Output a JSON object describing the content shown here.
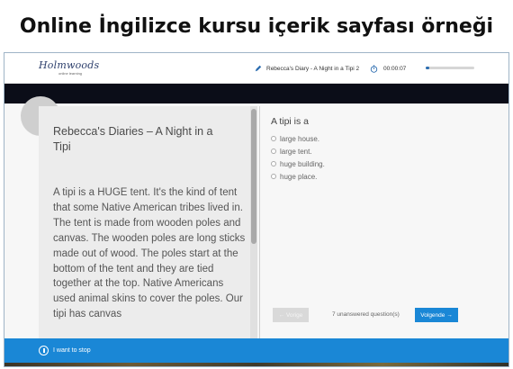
{
  "headline": "Online İngilizce kursu içerik sayfası örneği",
  "brand": {
    "logo_text": "Holmwoods",
    "logo_sub": "online learning"
  },
  "topbar": {
    "breadcrumb": "Rebecca's Diary - A Night in a Tipi 2",
    "timer": "00:00:07",
    "progress_fraction": 0.08
  },
  "reading": {
    "title": "Rebecca's Diaries – A Night in a Tipi",
    "body": "A tipi is a HUGE tent. It's the kind of tent that some Native American tribes lived in. The tent is made from wooden poles and canvas. The wooden poles are long sticks made out of wood. The poles start at the bottom of the tent and they are tied together at the top. Native Americans used animal skins to cover the poles. Our tipi has canvas"
  },
  "quiz": {
    "question": "A tipi is a",
    "options": [
      "large house.",
      "large tent.",
      "huge building.",
      "huge place."
    ]
  },
  "navigation": {
    "prev_label": "← Vorige",
    "unanswered": "7 unanswered question(s)",
    "next_label": "Volgende →"
  },
  "footer": {
    "stop_label": "I want to stop"
  },
  "colors": {
    "accent": "#1a87d6",
    "dark_band": "#0b0d18",
    "panel": "#ececec"
  },
  "icons": {
    "breadcrumb": "pencil-icon",
    "timer": "stopwatch-icon",
    "stop": "stop-icon"
  }
}
